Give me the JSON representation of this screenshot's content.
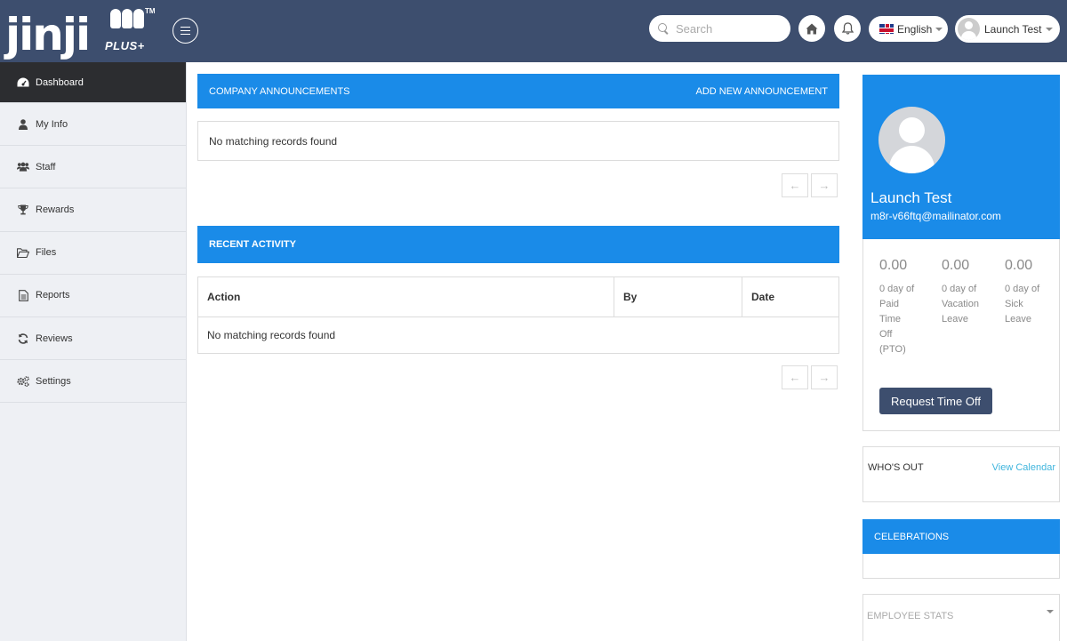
{
  "header": {
    "logo_text": "jinji",
    "logo_plus": "PLUS+",
    "logo_tm": "TM",
    "search_placeholder": "Search",
    "language": "English",
    "user_name": "Launch Test"
  },
  "sidebar": {
    "items": [
      {
        "label": "Dashboard",
        "icon": "dashboard-icon",
        "active": true
      },
      {
        "label": "My Info",
        "icon": "user-icon"
      },
      {
        "label": "Staff",
        "icon": "users-icon"
      },
      {
        "label": "Rewards",
        "icon": "trophy-icon"
      },
      {
        "label": "Files",
        "icon": "folder-open-icon"
      },
      {
        "label": "Reports",
        "icon": "file-text-icon"
      },
      {
        "label": "Reviews",
        "icon": "refresh-icon"
      },
      {
        "label": "Settings",
        "icon": "cogs-icon"
      }
    ]
  },
  "announcements": {
    "title": "COMPANY ANNOUNCEMENTS",
    "add_label": "ADD NEW ANNOUNCEMENT",
    "empty_text": "No matching records found",
    "prev": "←",
    "next": "→"
  },
  "activity": {
    "title": "RECENT ACTIVITY",
    "columns": [
      "Action",
      "By",
      "Date"
    ],
    "empty_text": "No matching records found",
    "prev": "←",
    "next": "→"
  },
  "profile": {
    "name": "Launch Test",
    "email": "m8r-v66ftq@mailinator.com"
  },
  "time_off": {
    "balances": [
      {
        "value": "0.00",
        "unit": "0 day of",
        "type": "Paid Time Off (PTO)"
      },
      {
        "value": "0.00",
        "unit": "0 day of",
        "type": "Vacation Leave"
      },
      {
        "value": "0.00",
        "unit": "0 day of",
        "type": "Sick Leave"
      }
    ],
    "request_label": "Request Time Off"
  },
  "whos_out": {
    "title": "WHO'S OUT",
    "link": "View Calendar"
  },
  "celebrations": {
    "title": "CELEBRATIONS"
  },
  "employee_stats": {
    "title": "EMPLOYEE STATS"
  },
  "colors": {
    "header_bg": "#3d4e6e",
    "accent_blue": "#1a8be8",
    "sidebar_bg": "#eef0f4",
    "sidebar_active": "#2c2d30",
    "link_cyan": "#3fb5dd"
  }
}
